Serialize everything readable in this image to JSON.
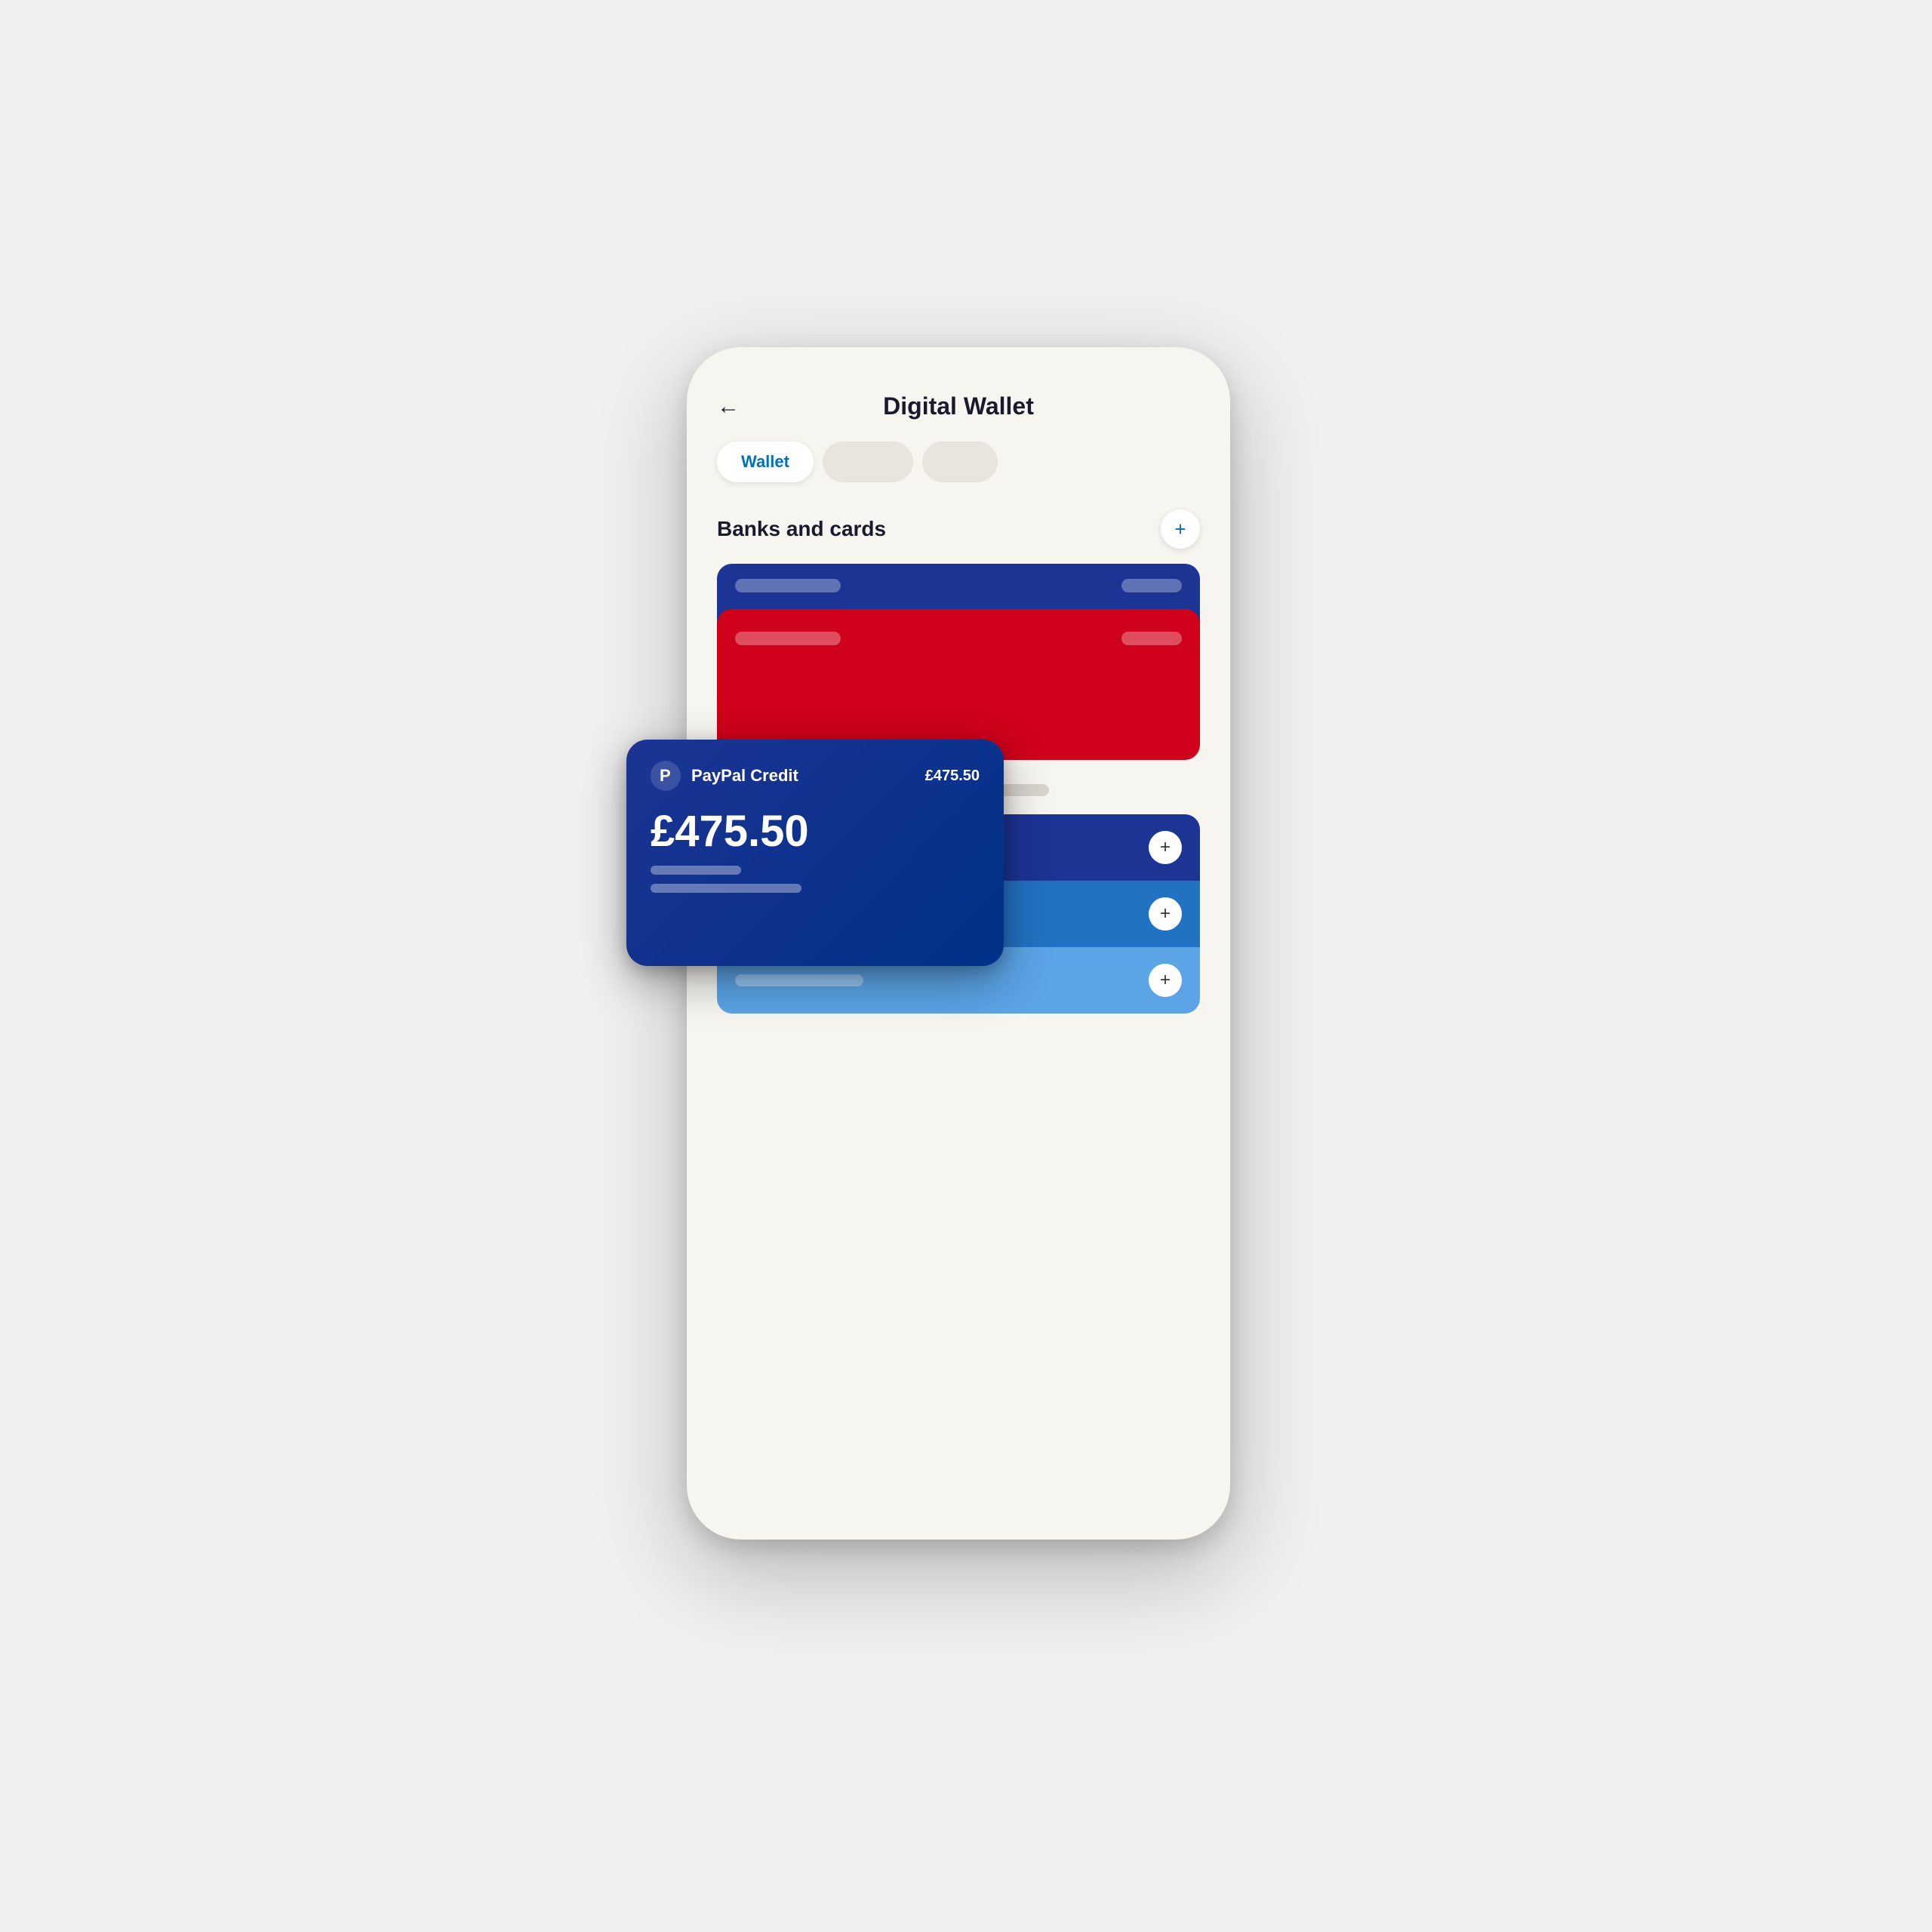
{
  "page": {
    "title": "Digital Wallet",
    "back_icon": "←",
    "tabs": [
      {
        "label": "Wallet",
        "active": true
      },
      {
        "label": "",
        "active": false
      },
      {
        "label": "",
        "active": false
      }
    ],
    "section": {
      "title": "Banks and cards",
      "add_button_label": "+"
    },
    "paypal_card": {
      "name": "PayPal Credit",
      "amount_small": "£475.50",
      "amount_large": "£475.50"
    },
    "list_items": [
      {
        "add_label": "+"
      },
      {
        "add_label": "+"
      },
      {
        "add_label": "+"
      }
    ],
    "icons": {
      "back": "←",
      "add": "+",
      "paypal_logo": "P"
    }
  }
}
